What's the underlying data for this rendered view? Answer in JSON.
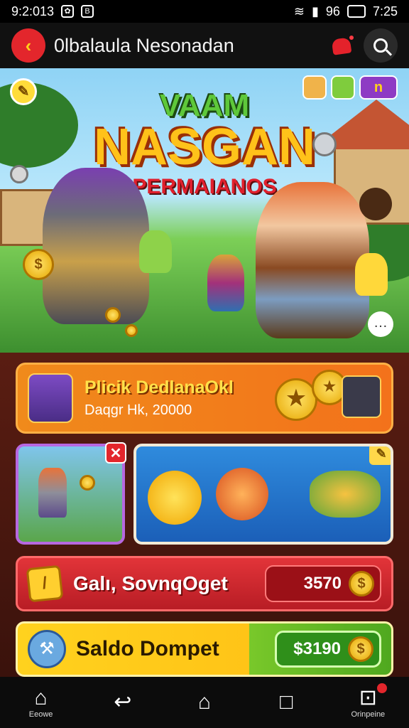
{
  "status": {
    "time_left": "9:2:013",
    "time_right": "7:25",
    "battery": "96"
  },
  "header": {
    "title": "0lbalaula Nesonadan"
  },
  "banner": {
    "line1": "VAAM",
    "line2": "NASGAN",
    "line3": "PERMAIANOS",
    "side_tag": "n"
  },
  "promo": {
    "title": "Plicik DedlanaOkl",
    "subtitle": "Daqgr Hk, 20000"
  },
  "rows": {
    "red": {
      "label": "Galı, SovnqOget",
      "value": "3570"
    },
    "yellow": {
      "label": "Saldo Dompet",
      "value": "$3190"
    }
  },
  "nav": {
    "home_label": "Eeowe",
    "profile_label": "Orinpeine"
  },
  "colors": {
    "accent": "#e3262c",
    "gold": "#ffc21a",
    "green": "#4fa81f"
  }
}
